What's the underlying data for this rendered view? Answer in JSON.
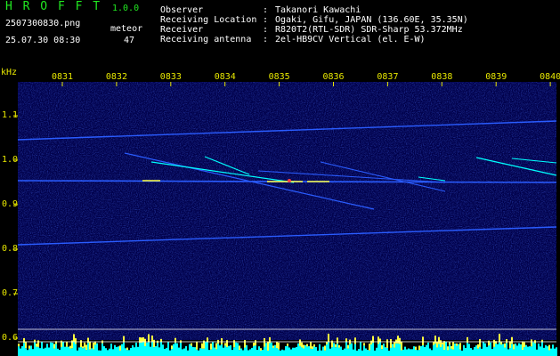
{
  "app": {
    "name": "H R O F F T",
    "version": "1.0.0"
  },
  "file": {
    "name": "2507300830.png",
    "datetime": "25.07.30 08:30"
  },
  "meteor": {
    "label": "meteor",
    "count": "47"
  },
  "info": [
    {
      "key": "Observer",
      "value": "Takanori Kawachi"
    },
    {
      "key": "Receiving Location",
      "value": "Ogaki, Gifu, JAPAN (136.60E, 35.35N)"
    },
    {
      "key": "Receiver",
      "value": "R820T2(RTL-SDR) SDR-Sharp 53.372MHz"
    },
    {
      "key": "Receiving antenna",
      "value": "2el-HB9CV Vertical (el. E-W)"
    }
  ],
  "axis": {
    "unit": "kHz",
    "time_labels": [
      "0831",
      "0832",
      "0833",
      "0834",
      "0835",
      "0836",
      "0837",
      "0838",
      "0839",
      "0840"
    ],
    "freq_labels": [
      "1.1",
      "1.0",
      "0.9",
      "0.8",
      "0.7",
      "0.6"
    ]
  },
  "colors": {
    "label": "#e8e800",
    "logo": "#21e821",
    "trace": "#2a5cff",
    "hot": "#ffff40",
    "signal": "#00ffff"
  }
}
